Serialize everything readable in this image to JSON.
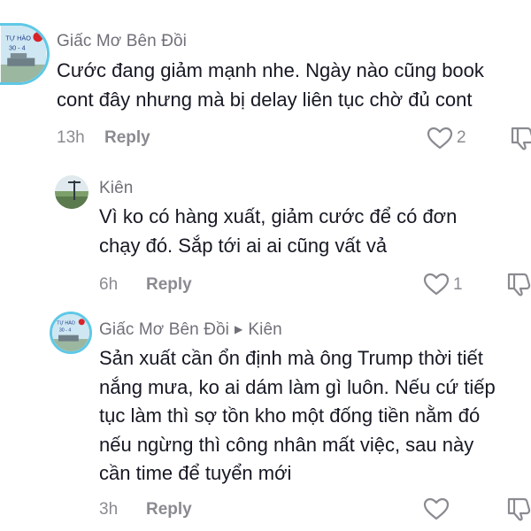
{
  "comments": [
    {
      "author": "Giấc Mơ Bên Đồi",
      "avatar": "tu-hao-30-4-avatar",
      "avatar_text_top": "TỰ HÀO",
      "avatar_text_bottom": "30 - 4",
      "text": "Cước đang giảm mạnh nhe. Ngày nào cũng book\ncont đây nhưng mà bị delay liên tục chờ đủ cont",
      "time": "13h",
      "reply_label": "Reply",
      "likes": "2"
    },
    {
      "author": "Kiên",
      "avatar": "landscape-avatar",
      "text": "Vì ko có hàng xuất, giảm cước để có đơn\nchạy đó. Sắp tới ai ai cũng vất vả",
      "time": "6h",
      "reply_label": "Reply",
      "likes": "1"
    },
    {
      "author": "Giấc Mơ Bên Đồi",
      "replying_to": "Kiên",
      "avatar": "tu-hao-30-4-avatar",
      "avatar_text_top": "TỰ HÀO",
      "avatar_text_bottom": "30 - 4",
      "text": "Sản xuất cần ổn định mà ông Trump thời tiết\nnắng mưa, ko ai dám làm gì luôn. Nếu cứ tiếp\ntục làm thì sợ tồn kho một đống tiền nằm đó\nnếu ngừng thì công nhân mất việc, sau này\ncần time để tuyển mới",
      "time": "3h",
      "reply_label": "Reply",
      "likes": ""
    }
  ],
  "colors": {
    "text": "#161823",
    "secondary": "#8a8b91",
    "avatar_ring": "#5ec8e6"
  },
  "icons": {
    "like": "heart-outline-icon",
    "dislike": "thumbs-down-icon",
    "reply_indicator": "triangle-right-icon"
  }
}
